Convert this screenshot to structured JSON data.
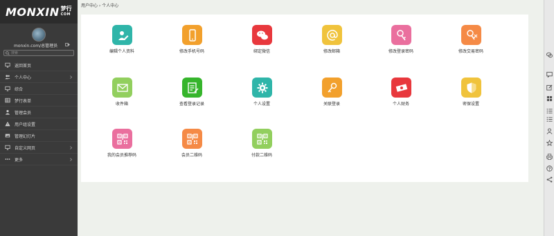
{
  "brand": {
    "logo_text": "MONXIN",
    "logo_cn": "梦行",
    "logo_com": "COM"
  },
  "user": {
    "line": "monxin.com/总管理员"
  },
  "search": {
    "placeholder": "搜索"
  },
  "sidebar": {
    "items": [
      {
        "label": "返回首页",
        "icon": "monitor-icon",
        "chevron": false
      },
      {
        "label": "个人中心",
        "icon": "users-icon",
        "chevron": true
      },
      {
        "label": "综合",
        "icon": "monitor-icon",
        "chevron": false
      },
      {
        "label": "梦行表单",
        "icon": "table-icon",
        "chevron": false
      },
      {
        "label": "管理会员",
        "icon": "user-icon",
        "chevron": false
      },
      {
        "label": "用户组设置",
        "icon": "warning-icon",
        "chevron": false
      },
      {
        "label": "管理幻灯片",
        "icon": "image-icon",
        "chevron": false
      },
      {
        "label": "自定义网页",
        "icon": "monitor-icon",
        "chevron": true
      },
      {
        "label": "更多",
        "icon": "more-icon",
        "chevron": true
      }
    ]
  },
  "breadcrumb": {
    "text": "用户中心 › 个人中心"
  },
  "tiles": [
    {
      "label": "编辑个人资料",
      "icon": "edit-profile-icon",
      "color": "#2fb5a9"
    },
    {
      "label": "修改手机号码",
      "icon": "phone-icon",
      "color": "#f2a02c"
    },
    {
      "label": "绑定微信",
      "icon": "wechat-icon",
      "color": "#e8383d"
    },
    {
      "label": "修改邮箱",
      "icon": "at-icon",
      "color": "#f0c33c"
    },
    {
      "label": "修改登录密码",
      "icon": "key-user-icon",
      "color": "#ea6f9e"
    },
    {
      "label": "修改交易密码",
      "icon": "key-icon",
      "color": "#f58a46"
    },
    {
      "label": "收件箱",
      "icon": "mail-icon",
      "color": "#92cf5e"
    },
    {
      "label": "查看登录记录",
      "icon": "log-icon",
      "color": "#36b52c"
    },
    {
      "label": "个人设置",
      "icon": "gear-icon",
      "color": "#2fb5a9"
    },
    {
      "label": "关联登录",
      "icon": "link-key-icon",
      "color": "#f2a02c"
    },
    {
      "label": "个人财务",
      "icon": "money-icon",
      "color": "#e8383d"
    },
    {
      "label": "密保设置",
      "icon": "shield-icon",
      "color": "#f0c33c"
    },
    {
      "label": "我的会员推荐码",
      "icon": "qrcode-icon",
      "color": "#ea6f9e"
    },
    {
      "label": "会员二维码",
      "icon": "qrcode-icon",
      "color": "#f58a46"
    },
    {
      "label": "付款二维码",
      "icon": "qrcode-icon",
      "color": "#92cf5e"
    }
  ],
  "rightbar": {
    "icons": [
      "chat-icon",
      "message-icon",
      "edit-icon",
      "grid-icon",
      "list-icon",
      "list-icon",
      "user-icon",
      "star-icon",
      "print-icon",
      "help-icon",
      "share-icon"
    ]
  }
}
